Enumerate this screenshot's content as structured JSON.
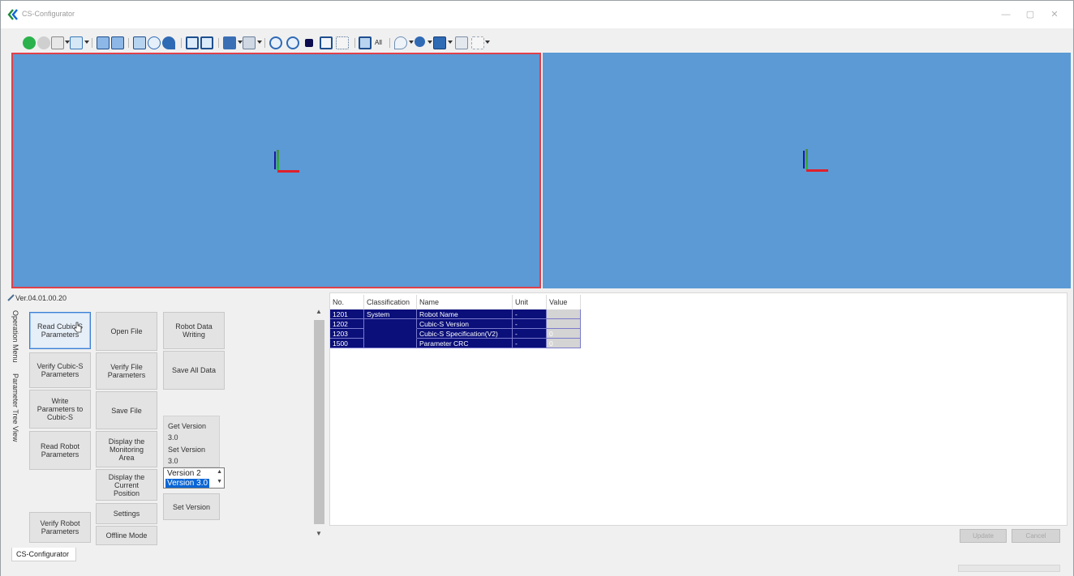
{
  "window": {
    "title": "CS-Configurator",
    "controls": {
      "minimize": "—",
      "maximize": "▢",
      "close": "✕"
    }
  },
  "toolbar": {
    "all_label": "All",
    "icons": [
      "go-icon",
      "stop-icon",
      "home-icon",
      "frame-icon",
      "view-front-icon",
      "view-back-icon",
      "view-top-icon",
      "view-left-icon",
      "view-right-icon",
      "window-1-icon",
      "window-2-icon",
      "save-icon",
      "camera-icon",
      "rotate-icon",
      "pan-icon",
      "solid-icon",
      "grid-icon",
      "all-icon",
      "select-icon",
      "zoom-icon",
      "table-icon",
      "screen-icon",
      "pointer-icon"
    ]
  },
  "viewports": {
    "left": {
      "background": "#5b9ad5",
      "border": "#e0404a"
    },
    "right": {
      "background": "#5b9ad5"
    }
  },
  "version_label": "Ver.04.01.00.20",
  "side_tabs": {
    "operation_menu": "Operation Menu",
    "parameter_tree_view": "Parameter Tree View"
  },
  "operations": {
    "read_cubic_s_parameters": "Read Cubic-S\nParameters",
    "verify_cubic_s_parameters": "Verify Cubic-S\nParameters",
    "write_parameters": "Write\nParameters to\nCubic-S",
    "read_robot_parameters": "Read Robot\nParameters",
    "verify_robot_parameters": "Verify Robot\nParameters",
    "open_file": "Open File",
    "verify_file_parameters": "Verify File\nParameters",
    "save_file": "Save File",
    "display_monitoring_area": "Display the\nMonitoring\nArea",
    "display_current_position": "Display the\nCurrent\nPosition",
    "settings": "Settings",
    "offline_mode": "Offline Mode",
    "robot_data_writing": "Robot Data\nWriting",
    "save_all_data": "Save All Data",
    "set_version_button": "Set Version"
  },
  "version_panel": {
    "get_version_label": "Get Version",
    "get_version_value": "3.0",
    "set_version_label": "Set Version",
    "set_version_value": "3.0",
    "options": [
      "Version 2",
      "Version 3.0"
    ],
    "selected": "Version 3.0"
  },
  "grid": {
    "columns": [
      "No.",
      "Classification",
      "Name",
      "Unit",
      "Value"
    ],
    "rows": [
      {
        "no": "1201",
        "classification": "System",
        "name": "Robot Name",
        "unit": "-",
        "value": ""
      },
      {
        "no": "1202",
        "classification": "",
        "name": "Cubic-S Version",
        "unit": "-",
        "value": ""
      },
      {
        "no": "1203",
        "classification": "",
        "name": "Cubic-S Specification(V2)",
        "unit": "-",
        "value": "0"
      },
      {
        "no": "1500",
        "classification": "",
        "name": "Parameter CRC",
        "unit": "-",
        "value": "0"
      }
    ],
    "selection_color": "#0a0f7a"
  },
  "grid_buttons": {
    "update": "Update",
    "cancel": "Cancel"
  },
  "bottom_tab": "CS-Configurator"
}
